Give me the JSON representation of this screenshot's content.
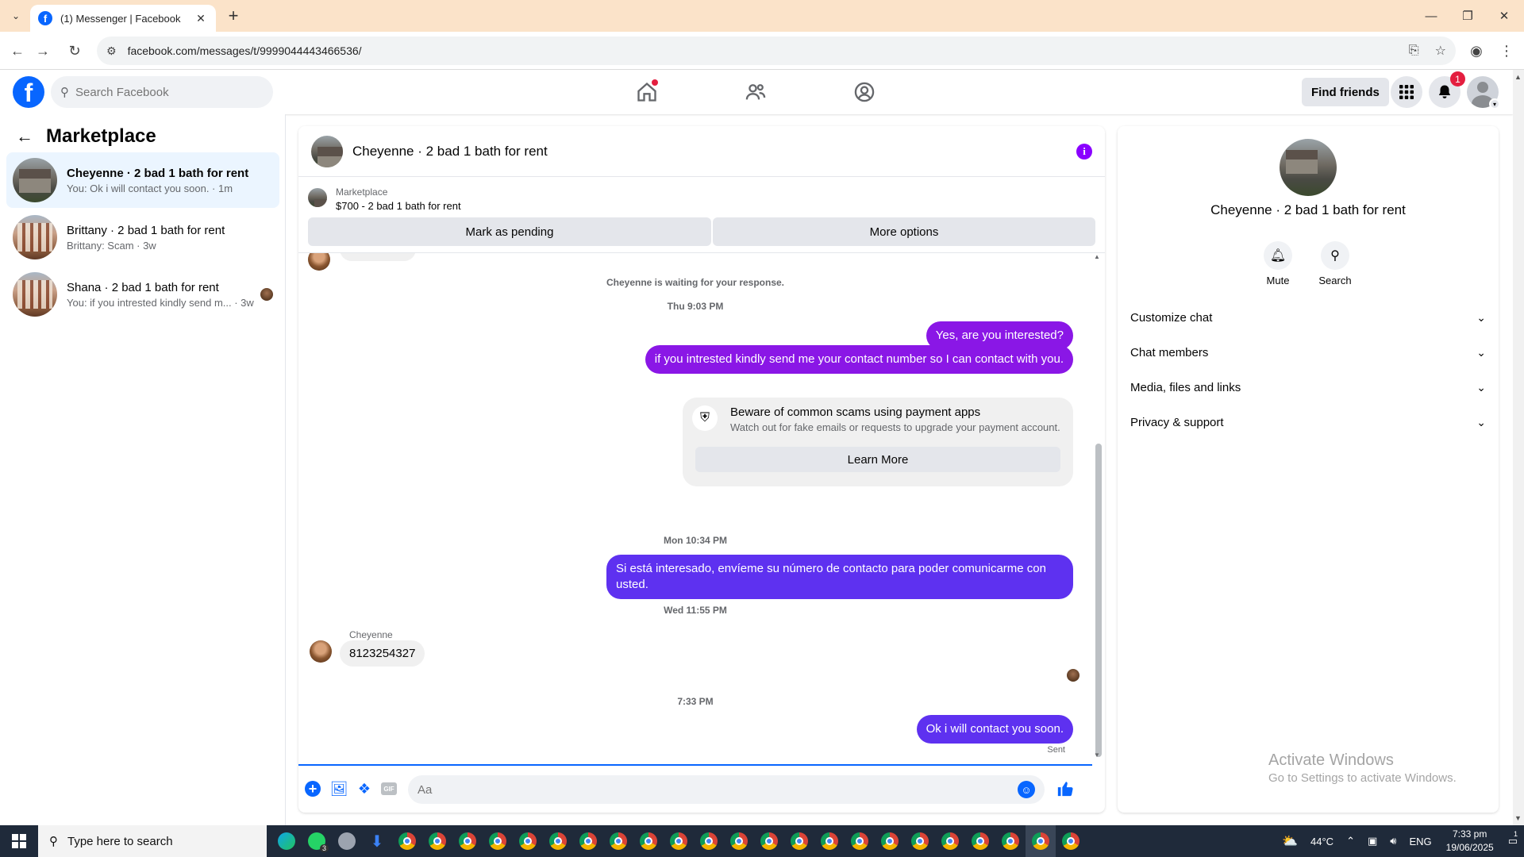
{
  "browser": {
    "tab_title": "(1) Messenger | Facebook",
    "url": "facebook.com/messages/t/9999044443466536/"
  },
  "fb_header": {
    "search_placeholder": "Search Facebook",
    "find_friends": "Find friends",
    "notification_count": "1"
  },
  "sidebar": {
    "title": "Marketplace",
    "conversations": [
      {
        "name": "Cheyenne · 2 bad 1 bath for rent",
        "preview": "You: Ok i will contact you soon. · 1m"
      },
      {
        "name": "Brittany · 2 bad 1 bath for rent",
        "preview": "Brittany: Scam · 3w"
      },
      {
        "name": "Shana · 2 bad 1 bath for rent",
        "preview": "You: if you intrested kindly send m... · 3w"
      }
    ]
  },
  "chat": {
    "title": "Cheyenne · 2 bad 1 bath for rent",
    "listing_label": "Marketplace",
    "listing_price": "$700 - 2 bad 1 bath for rent",
    "mark_pending": "Mark as pending",
    "more_options": "More options",
    "waiting_note": "Cheyenne is waiting for your response.",
    "ts1": "Thu 9:03 PM",
    "msg1": "Yes, are you interested?",
    "msg2": "if you intrested kindly send me your contact number so I can contact with you.",
    "scam_title": "Beware of common scams using payment apps",
    "scam_sub": "Watch out for fake emails or requests to upgrade your payment account.",
    "learn_more": "Learn More",
    "ts2": "Mon 10:34 PM",
    "msg3": "Si está interesado, envíeme su número de contacto para poder comunicarme con usted.",
    "ts3": "Wed 11:55 PM",
    "sender": "Cheyenne",
    "msg4": "8123254327",
    "ts4": "7:33 PM",
    "msg5": "Ok i will contact you soon.",
    "sent": "Sent",
    "composer_placeholder": "Aa"
  },
  "info": {
    "name": "Cheyenne · 2 bad 1 bath for rent",
    "mute": "Mute",
    "search": "Search",
    "sections": [
      "Customize chat",
      "Chat members",
      "Media, files and links",
      "Privacy & support"
    ],
    "watermark_title": "Activate Windows",
    "watermark_sub": "Go to Settings to activate Windows."
  },
  "taskbar": {
    "search_placeholder": "Type here to search",
    "temperature": "44°C",
    "language": "ENG",
    "time": "7:33 pm",
    "date": "19/06/2025",
    "whatsapp_badge": "3",
    "action_center_badge": "1"
  },
  "colors": {
    "fb_blue": "#0866ff",
    "bubble_purple": "#8a17e6",
    "bubble_indigo": "#5e31f0",
    "tab_strip": "#fbe3c9"
  }
}
